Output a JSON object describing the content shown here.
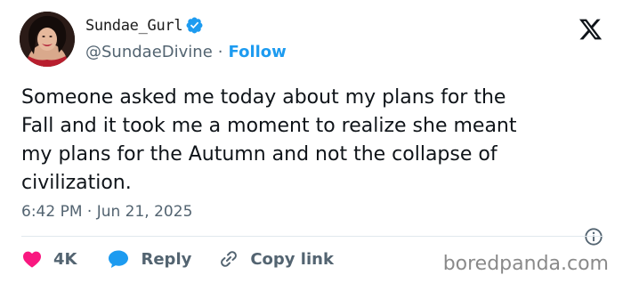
{
  "author": {
    "display_name": "Sundae_Gurl",
    "handle": "@SundaeDivine",
    "separator": "·",
    "follow_label": "Follow"
  },
  "tweet": {
    "lines": [
      "Someone asked me today about my plans for the",
      "Fall and it took me a moment to realize she meant",
      "my plans for the Autumn and not the collapse of",
      "civilization."
    ],
    "timestamp": "6:42 PM · Jun 21, 2025"
  },
  "actions": {
    "like_count": "4K",
    "reply_label": "Reply",
    "copy_link_label": "Copy link"
  },
  "watermark": "boredpanda.com",
  "colors": {
    "accent": "#1d9bf0",
    "like": "#f91880",
    "muted": "#536471"
  },
  "icons": [
    "x-logo-icon",
    "verified-badge-icon",
    "heart-icon",
    "reply-bubble-icon",
    "link-icon",
    "info-icon"
  ]
}
